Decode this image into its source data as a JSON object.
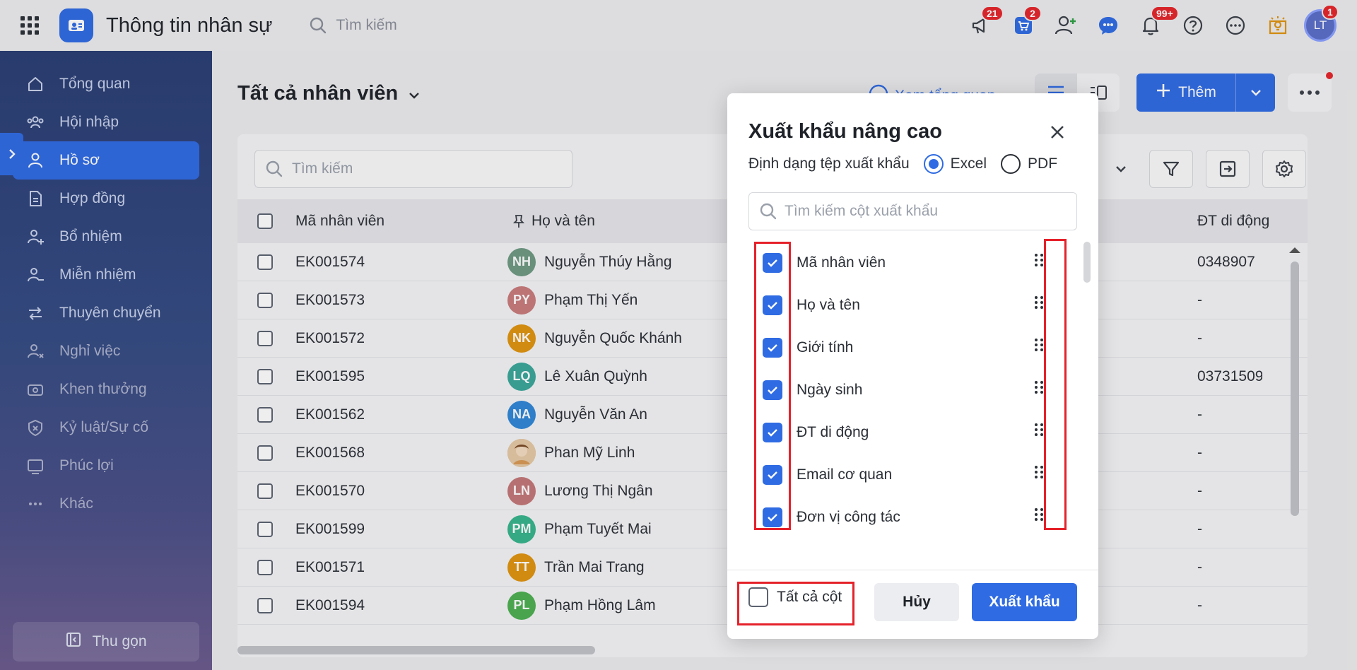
{
  "header": {
    "app_title": "Thông tin nhân sự",
    "search_placeholder": "Tìm kiếm",
    "badges": {
      "announcements": "21",
      "cart": "2",
      "notifications": "99+",
      "avatar": "1"
    },
    "avatar_initials": "LT"
  },
  "sidebar": {
    "items": [
      {
        "label": "Tổng quan",
        "icon": "home-icon"
      },
      {
        "label": "Hội nhập",
        "icon": "people-group-icon"
      },
      {
        "label": "Hồ sơ",
        "icon": "user-icon"
      },
      {
        "label": "Hợp đồng",
        "icon": "document-icon"
      },
      {
        "label": "Bổ nhiệm",
        "icon": "user-add-icon"
      },
      {
        "label": "Miễn nhiệm",
        "icon": "user-remove-icon"
      },
      {
        "label": "Thuyên chuyển",
        "icon": "transfer-icon"
      },
      {
        "label": "Nghỉ việc",
        "icon": "user-leave-icon"
      },
      {
        "label": "Khen thưởng",
        "icon": "reward-icon"
      },
      {
        "label": "Kỷ luật/Sự cố",
        "icon": "discipline-icon"
      },
      {
        "label": "Phúc lợi",
        "icon": "benefit-icon"
      },
      {
        "label": "Khác",
        "icon": "more-dots-icon"
      }
    ],
    "active_index": 2,
    "collapse_label": "Thu gọn"
  },
  "main": {
    "page_title": "Tất cả nhân viên",
    "overview_link": "Xem tổng quan",
    "add_button": "Thêm",
    "table_search_placeholder": "Tìm kiếm",
    "columns": {
      "code": "Mã nhân viên",
      "name": "Họ và tên",
      "phone": "ĐT di động"
    },
    "rows": [
      {
        "code": "EK001574",
        "initials": "NH",
        "name": "Nguyễn Thúy Hằng",
        "color": "#6e9a82",
        "phone": "0348907"
      },
      {
        "code": "EK001573",
        "initials": "PY",
        "name": "Phạm Thị Yến",
        "color": "#c97b7b",
        "phone": "-"
      },
      {
        "code": "EK001572",
        "initials": "NK",
        "name": "Nguyễn Quốc Khánh",
        "color": "#e0940f",
        "phone": "-"
      },
      {
        "code": "EK001595",
        "initials": "LQ",
        "name": "Lê Xuân Quỳnh",
        "color": "#3aa79a",
        "phone": "03731509"
      },
      {
        "code": "EK001562",
        "initials": "NA",
        "name": "Nguyễn Văn An",
        "color": "#2f86d6",
        "phone": "-"
      },
      {
        "code": "EK001568",
        "initials": "",
        "name": "Phan Mỹ Linh",
        "color": "#c9a27a",
        "phone": "-"
      },
      {
        "code": "EK001570",
        "initials": "LN",
        "name": "Lương Thị Ngân",
        "color": "#c47777",
        "phone": "-"
      },
      {
        "code": "EK001599",
        "initials": "PM",
        "name": "Phạm Tuyết Mai",
        "color": "#37b58a",
        "phone": "-"
      },
      {
        "code": "EK001571",
        "initials": "TT",
        "name": "Trần Mai Trang",
        "color": "#e0940f",
        "phone": "-"
      },
      {
        "code": "EK001594",
        "initials": "PL",
        "name": "Phạm Hồng Lâm",
        "color": "#4caf50",
        "phone": "-"
      }
    ]
  },
  "modal": {
    "title": "Xuất khẩu nâng cao",
    "format_label": "Định dạng tệp xuất khẩu",
    "format_excel": "Excel",
    "format_pdf": "PDF",
    "selected_format": "Excel",
    "search_placeholder": "Tìm kiếm cột xuất khẩu",
    "columns": [
      {
        "label": "Mã nhân viên",
        "checked": true
      },
      {
        "label": "Họ và tên",
        "checked": true
      },
      {
        "label": "Giới tính",
        "checked": true
      },
      {
        "label": "Ngày sinh",
        "checked": true
      },
      {
        "label": "ĐT di động",
        "checked": true
      },
      {
        "label": "Email cơ quan",
        "checked": true
      },
      {
        "label": "Đơn vị công tác",
        "checked": true
      }
    ],
    "all_columns_label": "Tất cả cột",
    "all_columns_checked": false,
    "cancel_label": "Hủy",
    "export_label": "Xuất khẩu"
  },
  "colors": {
    "accent": "#2f6be3",
    "highlight": "#e5212a",
    "sidebar": "#2a3d72"
  }
}
